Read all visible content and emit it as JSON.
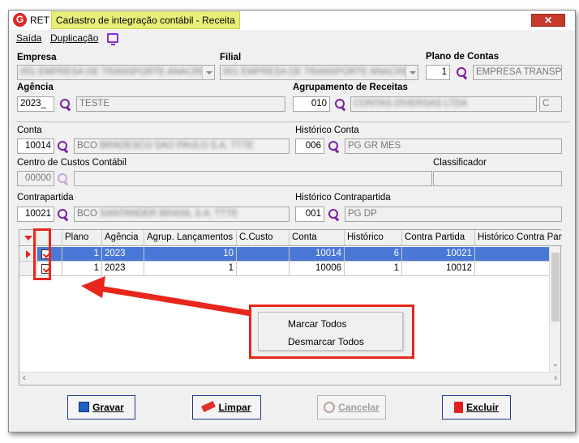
{
  "window": {
    "title_prefix": "RET -",
    "title_highlight": "Cadastro de integração contábil - Receita",
    "close_symbol": "✕"
  },
  "menu": {
    "items": [
      "Saída",
      "Duplicação"
    ]
  },
  "form": {
    "empresa": {
      "label": "Empresa",
      "value": "001 EMPRESA DE TRANSPORTE ANACRE"
    },
    "filial": {
      "label": "Filial",
      "value": "001 EMPRESA DE TRANSPORTE ANACRE"
    },
    "plano_contas": {
      "label": "Plano de Contas",
      "code": "1",
      "desc": "EMPRESA TRANSP A"
    },
    "agencia": {
      "label": "Agência",
      "code": "2023_",
      "desc": "TESTE"
    },
    "agrupamento": {
      "label": "Agrupamento de Receitas",
      "code": "010",
      "desc": "CONTAS DIVERSAS LTDA",
      "extra": "C"
    },
    "conta": {
      "label": "Conta",
      "code": "10014",
      "desc_prefix": "BCO",
      "desc_blurred": "BRADESCO SAO PAULO S.A. TTTE"
    },
    "historico_conta": {
      "label": "Histórico Conta",
      "code": "006",
      "desc": "PG GR MES"
    },
    "centro_custos": {
      "label": "Centro de Custos Contábil",
      "code": "00000",
      "desc": ""
    },
    "classificador": {
      "label": "Classificador",
      "value": ""
    },
    "contrapartida": {
      "label": "Contrapartida",
      "code": "10021",
      "desc_prefix": "BCO",
      "desc_blurred": "SANTANDER BRASIL S.A. TTTE"
    },
    "historico_contrapartida": {
      "label": "Histórico Contrapartida",
      "code": "001",
      "desc": "PG DP"
    }
  },
  "grid": {
    "headers": [
      "Plano",
      "Agência",
      "Agrup. Lançamentos",
      "C.Custo",
      "Conta",
      "Histórico",
      "Contra Partida",
      "Histórico Contra Parti"
    ],
    "rows": [
      {
        "plano": "1",
        "agencia": "2023",
        "agrup": "10",
        "ccusto": "",
        "conta": "10014",
        "historico": "6",
        "contra": "10021",
        "hist_contra": ""
      },
      {
        "plano": "1",
        "agencia": "2023",
        "agrup": "1",
        "ccusto": "",
        "conta": "10006",
        "historico": "1",
        "contra": "10012",
        "hist_contra": ""
      }
    ]
  },
  "context_menu": {
    "items": [
      "Marcar Todos",
      "Desmarcar Todos"
    ]
  },
  "buttons": {
    "gravar": "Gravar",
    "limpar": "Limpar",
    "cancelar": "Cancelar",
    "excluir": "Excluir"
  },
  "colors": {
    "accent": "#7b1fa2",
    "title_highlight": "#e9ee7a",
    "annotation_red": "#e8261c",
    "selected_row": "#4a78d6"
  }
}
